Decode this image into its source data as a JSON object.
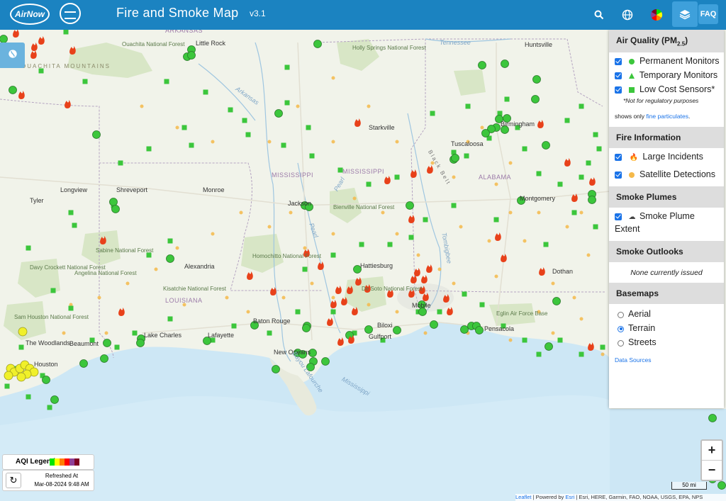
{
  "header": {
    "logo_airnow": "AirNow",
    "title": "Fire and Smoke Map",
    "version": "v3.1",
    "faq": "FAQ",
    "icons": [
      "search-icon",
      "globe-icon",
      "aqi-wheel-icon",
      "layers-icon"
    ]
  },
  "colors": {
    "header": "#1b83c1",
    "monitor_green": "#3cc63c",
    "sensor_yellow": "#f0f02a",
    "fire_red": "#e8411a",
    "satellite_orange": "#f5b94a",
    "water": "#cde7f5",
    "land": "#f1f3ea",
    "forest": "#cde2b8"
  },
  "map": {
    "labels": {
      "states": [
        "ARKANSAS",
        "MISSISSIPPI",
        "MISSISSIPPI",
        "ALABAMA",
        "LOUISIANA"
      ],
      "mountains": "OUACHITA MOUNTAINS",
      "cities": [
        "Little Rock",
        "Huntsville",
        "Starkville",
        "Birmingham",
        "Tuscaloosa",
        "Longview",
        "Shreveport",
        "Monroe",
        "Tyler",
        "Jackson",
        "Montgomery",
        "Alexandria",
        "Hattiesburg",
        "Dothan",
        "Baton Rouge",
        "Lake Charles",
        "Lafayette",
        "Beaumont",
        "Biloxi",
        "Gulfport",
        "Mobile",
        "Pensacola",
        "New Orleans",
        "The Woodlands",
        "Houston"
      ],
      "forests": [
        "Ouachita National Forest",
        "Holly Springs National Forest",
        "Bienville National Forest",
        "Homochitto National Forest",
        "Sabine National Forest",
        "Davy Crockett National Forest",
        "Angelina National Forest",
        "Kisatchie National Forest",
        "Sam Houston National Forest",
        "De Soto National Forest",
        "Eglin Air Force Base",
        "Black Belt"
      ],
      "water": [
        "Tennessee",
        "Arkansas",
        "Pearl",
        "Pearl",
        "Tombigbee",
        "Mississippi",
        "Bayou Lafourche"
      ]
    }
  },
  "panel": {
    "air_quality_title": "Air Quality (PM",
    "air_quality_sub": "2.5",
    "air_quality_close": ")",
    "permanent_monitors": "Permanent Monitors",
    "temporary_monitors": "Temporary Monitors",
    "low_cost_sensors": "Low Cost Sensors*",
    "not_regulatory": "*Not for regulatory purposes",
    "shows_only": "shows only ",
    "fine_particulates": "fine particulates",
    "fire_info_title": "Fire Information",
    "large_incidents": "Large Incidents",
    "satellite_detections": "Satellite Detections",
    "smoke_plumes_title": "Smoke Plumes",
    "smoke_plume_extent": "Smoke Plume Extent",
    "smoke_outlooks_title": "Smoke Outlooks",
    "none_issued": "None currently issued",
    "basemaps_title": "Basemaps",
    "basemaps": [
      {
        "label": "Aerial",
        "selected": false
      },
      {
        "label": "Terrain",
        "selected": true
      },
      {
        "label": "Streets",
        "selected": false
      }
    ],
    "data_sources": "Data Sources"
  },
  "legend": {
    "aqi_label": "AQI Legend",
    "aqi_colors": [
      "#00e400",
      "#ffff00",
      "#ff7e00",
      "#ff0000",
      "#8f3f97",
      "#7e0023"
    ],
    "refreshed_at": "Refreshed At",
    "refresh_time": "Mar-08-2024 9:48 AM"
  },
  "zoom": {
    "in": "+",
    "out": "−"
  },
  "scale_label": "50 mi",
  "attribution": {
    "leaflet": "Leaflet",
    "powered_by": " | Powered by ",
    "esri": "Esri",
    "rest": " | Esri, HERE, Garmin, FAO, NOAA, USGS, EPA, NPS"
  }
}
